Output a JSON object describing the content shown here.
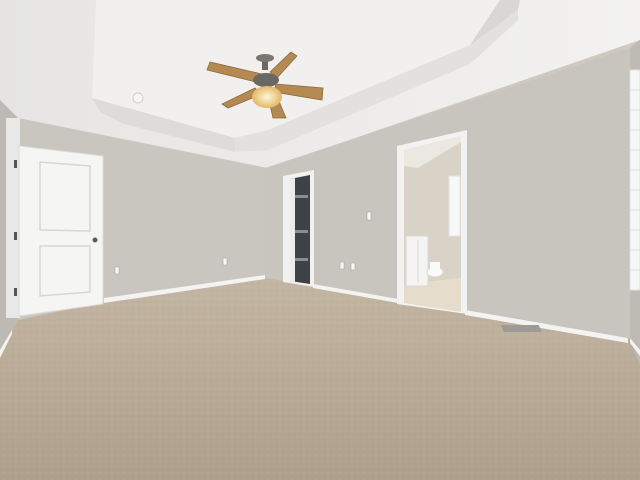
{
  "scene": {
    "description_free": true,
    "colors": {
      "ceiling": "#ecebe9",
      "tray_ceiling": "#f1f0ee",
      "wall_left": "#c9c6c0",
      "wall_back": "#c2bfb8",
      "wall_right": "#cbc8c1",
      "carpet": "#b9ab98",
      "trim": "#f4f4f2",
      "door": "#f5f5f3",
      "bath_wall": "#d9d3c7",
      "bath_floor": "#e6dccb",
      "closet_dark": "#3e4145",
      "fan_blade": "#b48a52",
      "fan_metal": "#6b6864",
      "light_glow": "#f3d79b"
    }
  }
}
